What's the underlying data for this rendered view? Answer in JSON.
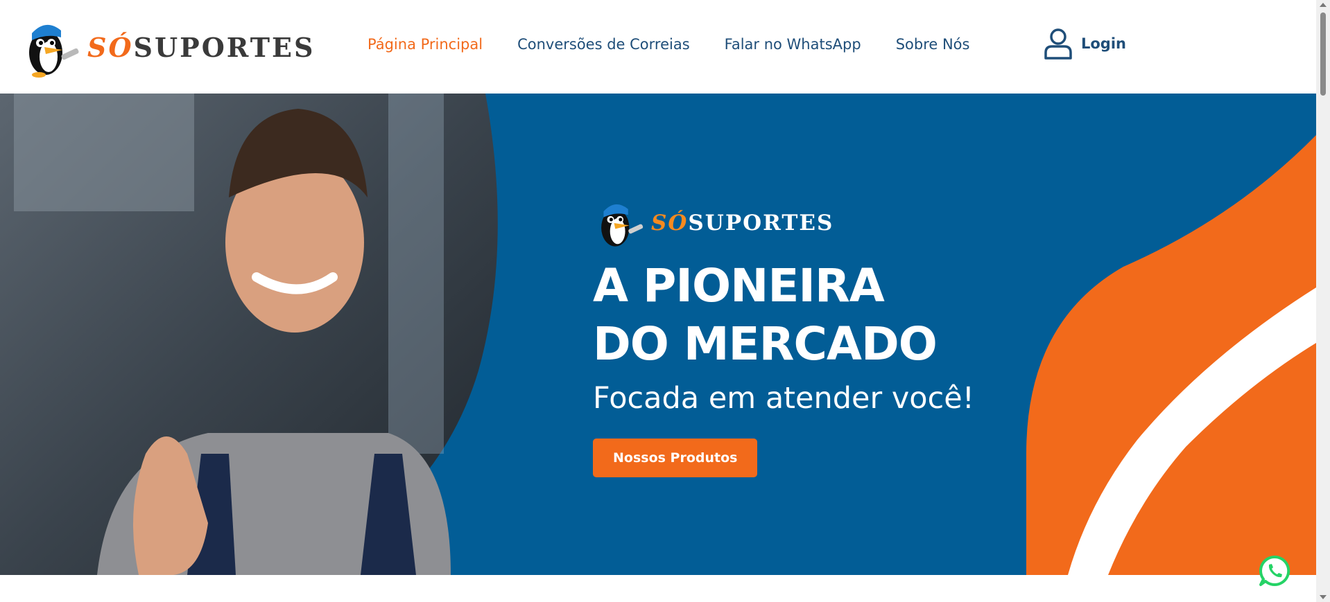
{
  "header": {
    "brand": {
      "so": "SÓ",
      "rest": "SUPORTES"
    },
    "nav": [
      {
        "label": "Página Principal",
        "active": true
      },
      {
        "label": "Conversões de Correias",
        "active": false
      },
      {
        "label": "Falar no WhatsApp",
        "active": false
      },
      {
        "label": "Sobre Nós",
        "active": false
      }
    ],
    "login_label": "Login"
  },
  "hero": {
    "brand": {
      "so": "SÓ",
      "rest": "SUPORTES"
    },
    "headline_line1": "A PIONEIRA",
    "headline_line2": "DO MERCADO",
    "subheadline": "Focada em atender você!",
    "cta_label": "Nossos Produtos"
  },
  "colors": {
    "primary_blue": "#025d96",
    "accent_orange": "#f26a1b",
    "nav_text": "#1f4e79",
    "whatsapp_green": "#25d366"
  },
  "icons": [
    "penguin-mascot-logo",
    "user-icon",
    "whatsapp-icon"
  ]
}
